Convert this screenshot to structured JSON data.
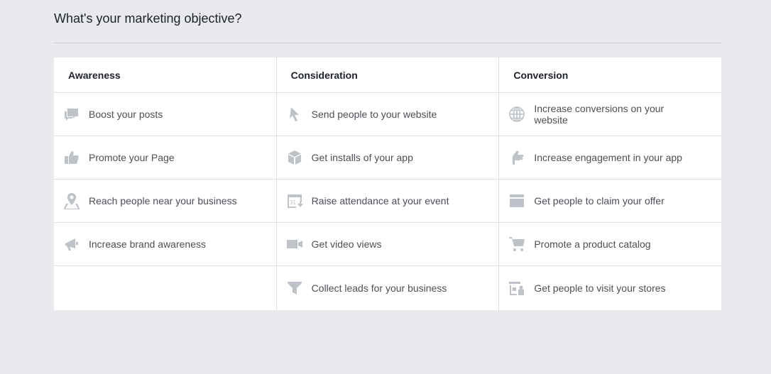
{
  "header": {
    "title": "What's your marketing objective?"
  },
  "columns": [
    {
      "title": "Awareness",
      "items": [
        {
          "label": "Boost your posts",
          "icon": "speech-bubbles-icon"
        },
        {
          "label": "Promote your Page",
          "icon": "thumbs-up-icon"
        },
        {
          "label": "Reach people near your business",
          "icon": "location-pin-icon"
        },
        {
          "label": "Increase brand awareness",
          "icon": "megaphone-icon"
        }
      ]
    },
    {
      "title": "Consideration",
      "items": [
        {
          "label": "Send people to your website",
          "icon": "cursor-icon"
        },
        {
          "label": "Get installs of your app",
          "icon": "box-icon"
        },
        {
          "label": "Raise attendance at your event",
          "icon": "calendar-icon"
        },
        {
          "label": "Get video views",
          "icon": "video-camera-icon"
        },
        {
          "label": "Collect leads for your business",
          "icon": "funnel-icon"
        }
      ]
    },
    {
      "title": "Conversion",
      "items": [
        {
          "label": "Increase conversions on your website",
          "icon": "globe-icon"
        },
        {
          "label": "Increase engagement in your app",
          "icon": "hand-icon"
        },
        {
          "label": "Get people to claim your offer",
          "icon": "storefront-icon"
        },
        {
          "label": "Promote a product catalog",
          "icon": "shopping-cart-icon"
        },
        {
          "label": "Get people to visit your stores",
          "icon": "store-visit-icon"
        }
      ]
    }
  ],
  "colors": {
    "background": "#e9eaed",
    "panel": "#ffffff",
    "icon": "#bec3c9",
    "text": "#4b4f56",
    "heading": "#1d2129"
  }
}
